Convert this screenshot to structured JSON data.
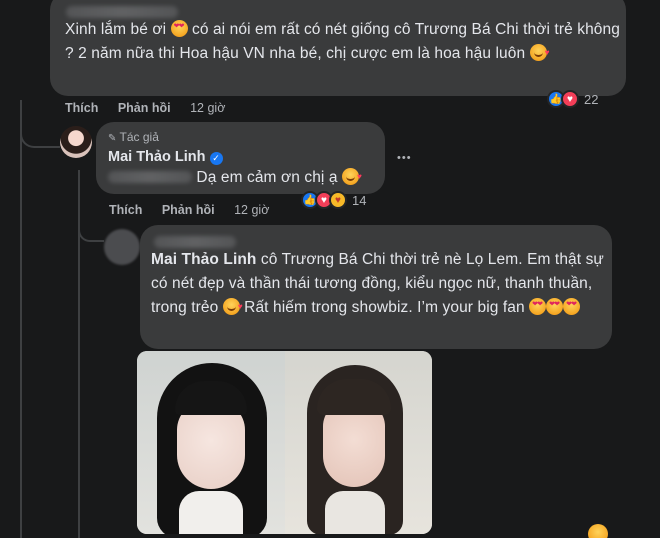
{
  "comment1": {
    "text_parts": [
      "Xinh lắm bé ơi ",
      " có ai nói em rất có nét giống cô Trương Bá Chi thời trẻ không ? 2 năm nữa thi Hoa hậu VN nha bé, chị cược em là hoa hậu luôn "
    ],
    "emojis": [
      "heart-eyes",
      "smile-hearts"
    ],
    "actions": {
      "like": "Thích",
      "reply": "Phản hồi",
      "time": "12 giờ"
    },
    "reaction_count": "22",
    "reaction_icons": [
      "like-icon",
      "love-icon"
    ]
  },
  "reply1": {
    "badge": "Tác giả",
    "author": "Mai Thảo Linh",
    "text": "Dạ em cảm ơn chị ạ ",
    "emoji": "smile-hearts",
    "more": "•••",
    "actions": {
      "like": "Thích",
      "reply": "Phản hồi",
      "time": "12 giờ"
    },
    "reaction_count": "14",
    "reaction_icons": [
      "like-icon",
      "love-icon",
      "care-icon"
    ]
  },
  "reply2": {
    "mention": "Mai Thảo Linh",
    "text_a": " cô Trương Bá Chi thời trẻ nè Lọ Lem. Em thật sự có nét đẹp và thần thái tương đồng, kiểu ngọc nữ, thanh thuần, trong trẻo ",
    "text_b": " Rất hiếm trong showbiz. I’m your big fan ",
    "emojis": [
      "smile-hearts",
      "heart-eyes",
      "heart-eyes",
      "heart-eyes"
    ],
    "image": "photo-collage"
  },
  "colors": {
    "background": "#18191a",
    "bubble": "#3a3b3c",
    "text": "#e4e6eb",
    "muted": "#b0b3b8",
    "verified": "#1877f2"
  }
}
